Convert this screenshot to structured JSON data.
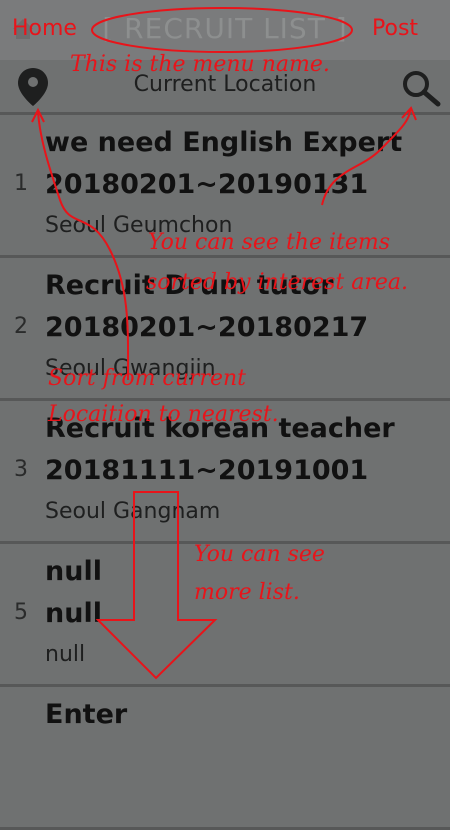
{
  "header": {
    "menu_name": "[ RECRUIT LIST ]"
  },
  "toolbar": {
    "location_label": "Current Location"
  },
  "rows": [
    {
      "num": "1",
      "title": "we need English Expert",
      "dates": "20180201~20190131",
      "area": "Seoul Geumchon"
    },
    {
      "num": "2",
      "title": "Recruit Drum tutor",
      "dates": "20180201~20180217",
      "area": "Seoul Gwangjin"
    },
    {
      "num": "3",
      "title": "Recruit korean teacher",
      "dates": "20181111~20191001",
      "area": "Seoul Gangnam"
    },
    {
      "num": "5",
      "title": "null",
      "dates": "null",
      "area": "null"
    },
    {
      "num": "",
      "title": "Enter",
      "dates": "",
      "area": ""
    }
  ],
  "annotations": {
    "home": "Home",
    "post": "Post",
    "menu": "This is the menu name.",
    "sorted": "You can see the items",
    "sorted2": "sorted by interest area.",
    "nearest1": "Sort from current",
    "nearest2": "Locaition to nearest.",
    "more1": "You can see",
    "more2": "more list."
  },
  "colors": {
    "annotation": "#e8141a",
    "dim_background": "#6f7171"
  }
}
